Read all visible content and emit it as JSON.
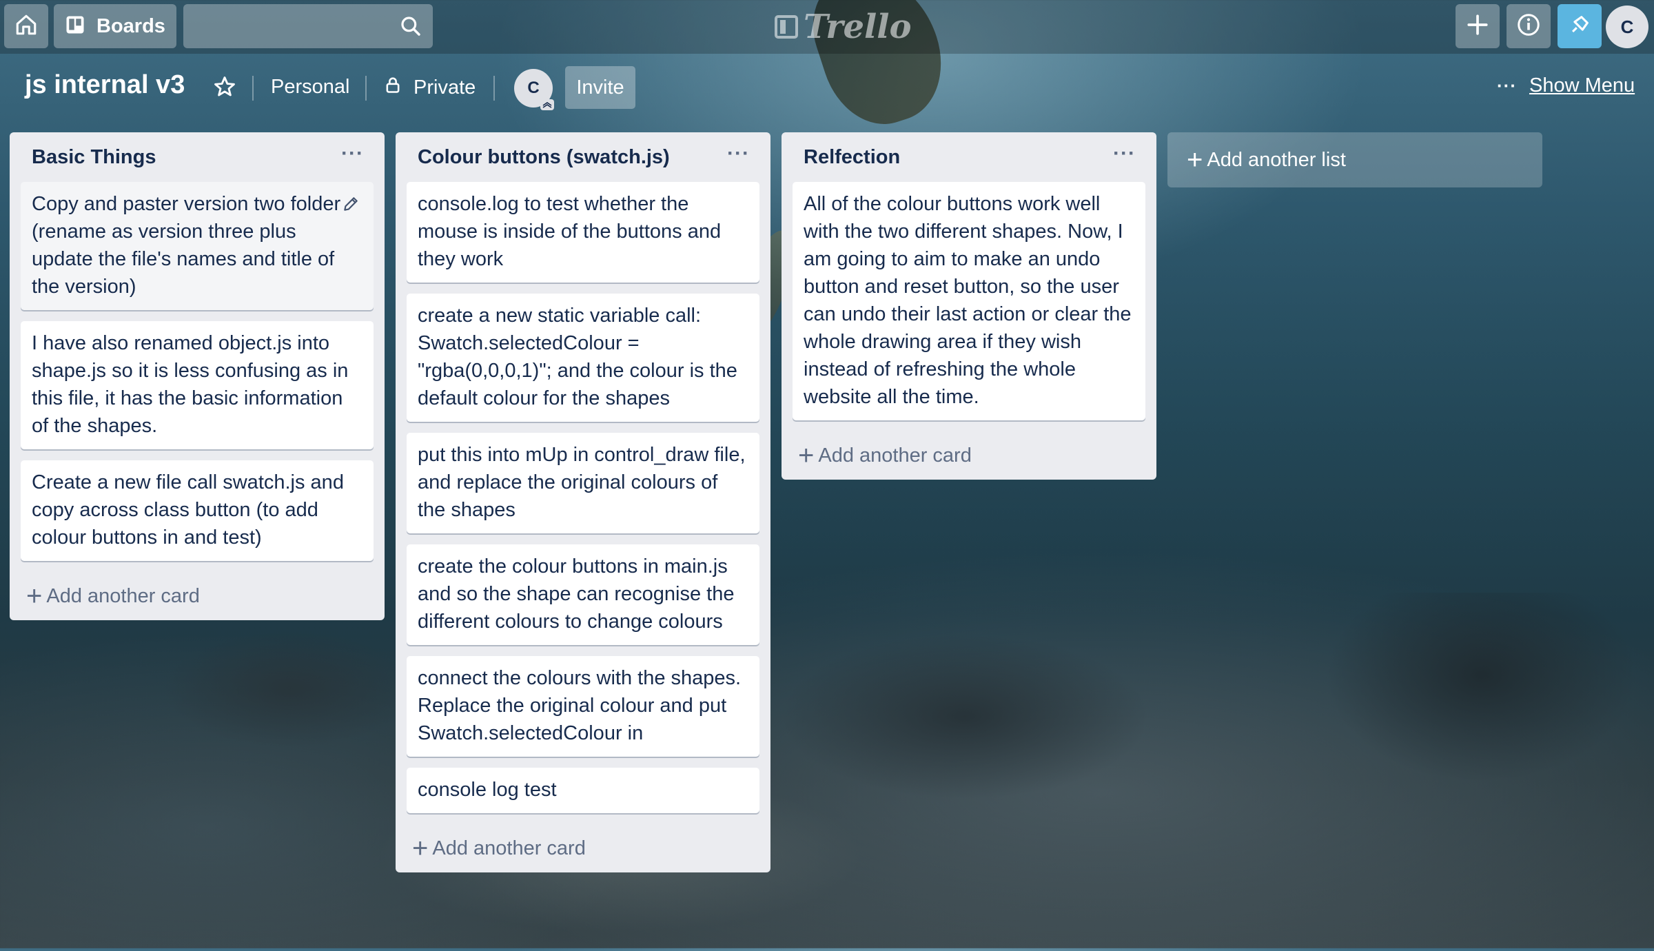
{
  "header": {
    "boards_label": "Boards",
    "search_placeholder": "",
    "logo_text": "Trello",
    "user_initial": "C"
  },
  "board": {
    "title": "js internal v3",
    "team": "Personal",
    "visibility": "Private",
    "member_initial": "C",
    "invite_label": "Invite",
    "show_menu_label": "Show Menu"
  },
  "lists": [
    {
      "title": "Basic Things",
      "cards": [
        "Copy and paster version two folder (rename as version three plus update the file's names and title of the version)",
        "I have also renamed object.js into shape.js so it is less confusing as in this file, it has the basic information of the shapes.",
        "Create a new file call swatch.js and copy across class button (to add colour buttons in and test)"
      ],
      "add_card_label": "Add another card"
    },
    {
      "title": "Colour buttons (swatch.js)",
      "cards": [
        "console.log to test whether the mouse is inside of the buttons and they work",
        "create a new static variable call: Swatch.selectedColour = \"rgba(0,0,0,1)\"; and the colour is the default colour for the shapes",
        "put this into mUp in control_draw file, and replace the original colours of the shapes",
        "create the colour buttons in main.js and so the shape can recognise the different colours to change colours",
        "connect the colours with the shapes. Replace the original colour and put Swatch.selectedColour in",
        "console log test"
      ],
      "add_card_label": "Add another card"
    },
    {
      "title": "Relfection",
      "cards": [
        "All of the colour buttons work well with the two different shapes. Now, I am going to aim to make an undo button and reset button, so the user can undo their last action or clear the whole drawing area if they wish instead of refreshing the whole website all the time."
      ],
      "add_card_label": "Add another card"
    }
  ],
  "add_list_label": "Add another list",
  "colors": {
    "list_bg": "#ebecf0",
    "card_text": "#172b4d",
    "muted_text": "#5e6c84",
    "notification_button": "#5bb5e0"
  },
  "icons": [
    "home-icon",
    "boards-icon",
    "search-icon",
    "plus-icon",
    "info-icon",
    "notification-icon",
    "star-icon",
    "lock-icon",
    "more-icon",
    "pencil-icon"
  ]
}
